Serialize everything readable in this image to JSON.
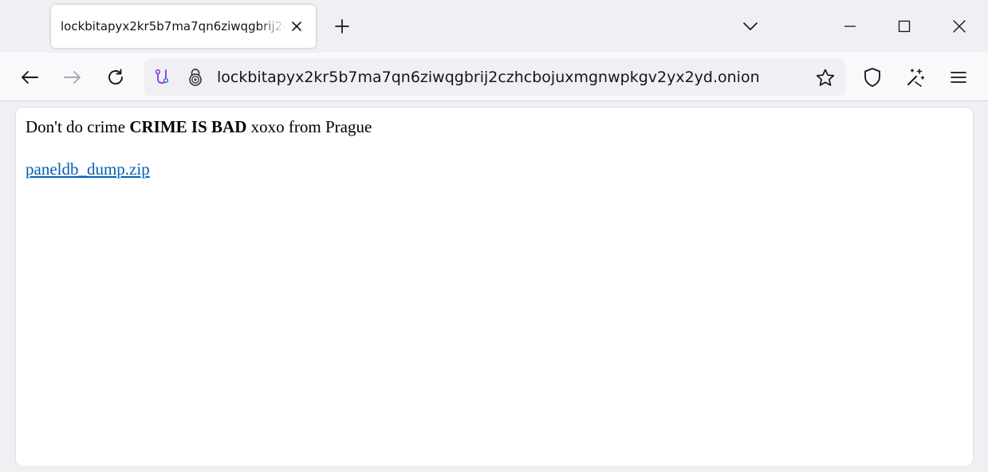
{
  "tab": {
    "title": "lockbitapyx2kr5b7ma7qn6ziwqgbrij2czhcbojuxmgnwpkgv2yx2yd.onion",
    "close_icon": "close-icon"
  },
  "tabstrip": {
    "new_tab_icon": "plus-icon",
    "list_tabs_icon": "chevron-down-icon"
  },
  "window_controls": {
    "minimize_icon": "minimize-icon",
    "maximize_icon": "maximize-icon",
    "close_icon": "close-icon"
  },
  "navigation": {
    "back_icon": "back-arrow-icon",
    "forward_icon": "forward-arrow-icon",
    "reload_icon": "reload-icon"
  },
  "urlbar": {
    "url": "lockbitapyx2kr5b7ma7qn6ziwqgbrij2czhcbojuxmgnwpkgv2yx2yd.onion",
    "extra_icon": "circuit-icon",
    "lock_icon": "onion-lock-icon",
    "bookmark_icon": "star-icon"
  },
  "toolbar": {
    "shield_icon": "shield-icon",
    "magic_icon": "magic-wand-icon",
    "menu_icon": "hamburger-menu-icon"
  },
  "page": {
    "text_before": "Don't do crime ",
    "text_bold": "CRIME IS BAD",
    "text_after": " xoxo from Prague",
    "link_text": "paneldb_dump.zip"
  },
  "colors": {
    "link": "#0060b8",
    "chrome": "#f0f0f4",
    "toolbar": "#f9f9fb",
    "circuit_icon": "#8f3fd8"
  }
}
